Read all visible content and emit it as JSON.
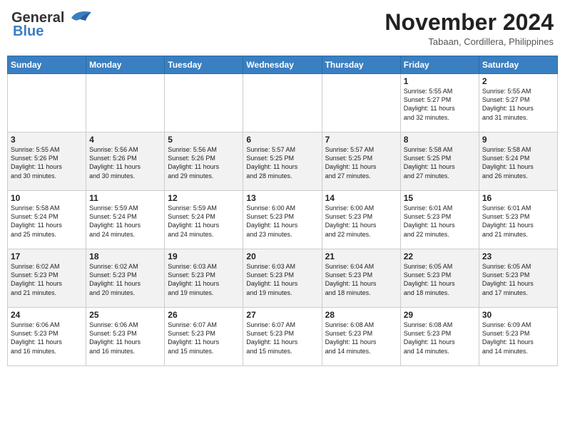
{
  "header": {
    "logo": {
      "line1": "General",
      "line2": "Blue"
    },
    "title": "November 2024",
    "location": "Tabaan, Cordillera, Philippines"
  },
  "weekdays": [
    "Sunday",
    "Monday",
    "Tuesday",
    "Wednesday",
    "Thursday",
    "Friday",
    "Saturday"
  ],
  "weeks": [
    [
      {
        "day": "",
        "info": ""
      },
      {
        "day": "",
        "info": ""
      },
      {
        "day": "",
        "info": ""
      },
      {
        "day": "",
        "info": ""
      },
      {
        "day": "",
        "info": ""
      },
      {
        "day": "1",
        "info": "Sunrise: 5:55 AM\nSunset: 5:27 PM\nDaylight: 11 hours\nand 32 minutes."
      },
      {
        "day": "2",
        "info": "Sunrise: 5:55 AM\nSunset: 5:27 PM\nDaylight: 11 hours\nand 31 minutes."
      }
    ],
    [
      {
        "day": "3",
        "info": "Sunrise: 5:55 AM\nSunset: 5:26 PM\nDaylight: 11 hours\nand 30 minutes."
      },
      {
        "day": "4",
        "info": "Sunrise: 5:56 AM\nSunset: 5:26 PM\nDaylight: 11 hours\nand 30 minutes."
      },
      {
        "day": "5",
        "info": "Sunrise: 5:56 AM\nSunset: 5:26 PM\nDaylight: 11 hours\nand 29 minutes."
      },
      {
        "day": "6",
        "info": "Sunrise: 5:57 AM\nSunset: 5:25 PM\nDaylight: 11 hours\nand 28 minutes."
      },
      {
        "day": "7",
        "info": "Sunrise: 5:57 AM\nSunset: 5:25 PM\nDaylight: 11 hours\nand 27 minutes."
      },
      {
        "day": "8",
        "info": "Sunrise: 5:58 AM\nSunset: 5:25 PM\nDaylight: 11 hours\nand 27 minutes."
      },
      {
        "day": "9",
        "info": "Sunrise: 5:58 AM\nSunset: 5:24 PM\nDaylight: 11 hours\nand 26 minutes."
      }
    ],
    [
      {
        "day": "10",
        "info": "Sunrise: 5:58 AM\nSunset: 5:24 PM\nDaylight: 11 hours\nand 25 minutes."
      },
      {
        "day": "11",
        "info": "Sunrise: 5:59 AM\nSunset: 5:24 PM\nDaylight: 11 hours\nand 24 minutes."
      },
      {
        "day": "12",
        "info": "Sunrise: 5:59 AM\nSunset: 5:24 PM\nDaylight: 11 hours\nand 24 minutes."
      },
      {
        "day": "13",
        "info": "Sunrise: 6:00 AM\nSunset: 5:23 PM\nDaylight: 11 hours\nand 23 minutes."
      },
      {
        "day": "14",
        "info": "Sunrise: 6:00 AM\nSunset: 5:23 PM\nDaylight: 11 hours\nand 22 minutes."
      },
      {
        "day": "15",
        "info": "Sunrise: 6:01 AM\nSunset: 5:23 PM\nDaylight: 11 hours\nand 22 minutes."
      },
      {
        "day": "16",
        "info": "Sunrise: 6:01 AM\nSunset: 5:23 PM\nDaylight: 11 hours\nand 21 minutes."
      }
    ],
    [
      {
        "day": "17",
        "info": "Sunrise: 6:02 AM\nSunset: 5:23 PM\nDaylight: 11 hours\nand 21 minutes."
      },
      {
        "day": "18",
        "info": "Sunrise: 6:02 AM\nSunset: 5:23 PM\nDaylight: 11 hours\nand 20 minutes."
      },
      {
        "day": "19",
        "info": "Sunrise: 6:03 AM\nSunset: 5:23 PM\nDaylight: 11 hours\nand 19 minutes."
      },
      {
        "day": "20",
        "info": "Sunrise: 6:03 AM\nSunset: 5:23 PM\nDaylight: 11 hours\nand 19 minutes."
      },
      {
        "day": "21",
        "info": "Sunrise: 6:04 AM\nSunset: 5:23 PM\nDaylight: 11 hours\nand 18 minutes."
      },
      {
        "day": "22",
        "info": "Sunrise: 6:05 AM\nSunset: 5:23 PM\nDaylight: 11 hours\nand 18 minutes."
      },
      {
        "day": "23",
        "info": "Sunrise: 6:05 AM\nSunset: 5:23 PM\nDaylight: 11 hours\nand 17 minutes."
      }
    ],
    [
      {
        "day": "24",
        "info": "Sunrise: 6:06 AM\nSunset: 5:23 PM\nDaylight: 11 hours\nand 16 minutes."
      },
      {
        "day": "25",
        "info": "Sunrise: 6:06 AM\nSunset: 5:23 PM\nDaylight: 11 hours\nand 16 minutes."
      },
      {
        "day": "26",
        "info": "Sunrise: 6:07 AM\nSunset: 5:23 PM\nDaylight: 11 hours\nand 15 minutes."
      },
      {
        "day": "27",
        "info": "Sunrise: 6:07 AM\nSunset: 5:23 PM\nDaylight: 11 hours\nand 15 minutes."
      },
      {
        "day": "28",
        "info": "Sunrise: 6:08 AM\nSunset: 5:23 PM\nDaylight: 11 hours\nand 14 minutes."
      },
      {
        "day": "29",
        "info": "Sunrise: 6:08 AM\nSunset: 5:23 PM\nDaylight: 11 hours\nand 14 minutes."
      },
      {
        "day": "30",
        "info": "Sunrise: 6:09 AM\nSunset: 5:23 PM\nDaylight: 11 hours\nand 14 minutes."
      }
    ]
  ]
}
